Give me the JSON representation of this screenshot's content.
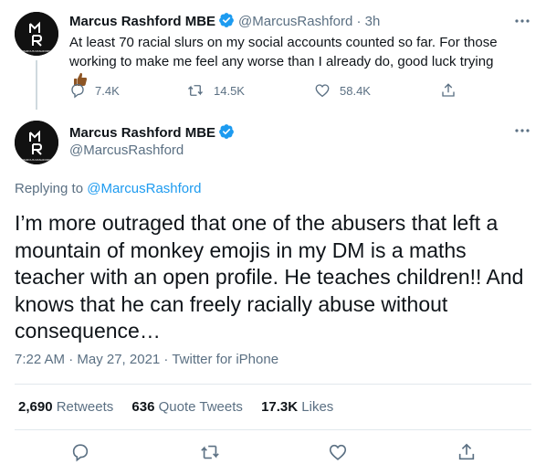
{
  "parent_tweet": {
    "author_name": "Marcus Rashford MBE",
    "handle": "@MarcusRashford",
    "separator": "·",
    "time": "3h",
    "text": "At least 70 racial slurs on my social accounts counted so far. For those working to make me feel any worse than I already do, good luck trying",
    "emoji": "thumbs-up-medium-dark-skin",
    "replies": "7.4K",
    "retweets": "14.5K",
    "likes": "58.4K"
  },
  "main_tweet": {
    "author_name": "Marcus Rashford MBE",
    "handle": "@MarcusRashford",
    "replying_prefix": "Replying to",
    "replying_to": "@MarcusRashford",
    "text": "I’m more outraged that one of the abusers that left a mountain of monkey emojis in my DM is a maths teacher with an open profile. He teaches children!! And knows that he can freely racially abuse without consequence…",
    "timestamp": "7:22 AM · May 27, 2021 · ",
    "source": "Twitter for iPhone",
    "retweets_count": "2,690",
    "retweets_label": "Retweets",
    "quote_count": "636",
    "quote_label": "Quote Tweets",
    "likes_count": "17.3K",
    "likes_label": "Likes"
  },
  "avatar": {
    "logo_text": "MARCUS RASHFORD",
    "bg": "#111111",
    "fg": "#ffffff"
  },
  "icons": [
    "verified-badge-icon",
    "more-options-icon",
    "reply-icon",
    "retweet-icon",
    "like-icon",
    "share-icon"
  ],
  "colors": {
    "verified": "#1d9bf0",
    "link": "#1d9bf0",
    "muted": "#5b7083",
    "text": "#0f1419",
    "line": "#cfd9de"
  }
}
